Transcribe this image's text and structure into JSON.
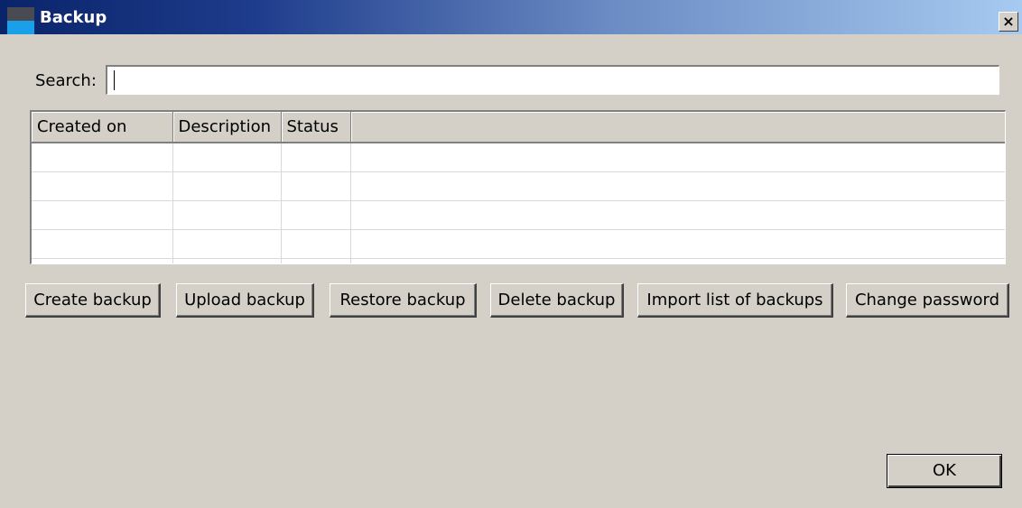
{
  "window": {
    "title": "Backup",
    "close_glyph": "×"
  },
  "search": {
    "label": "Search:",
    "value": "",
    "placeholder": ""
  },
  "table": {
    "columns": [
      "Created on",
      "Description",
      "Status"
    ],
    "rows": []
  },
  "actions": {
    "create": "Create backup",
    "upload": "Upload backup",
    "restore": "Restore backup",
    "delete": "Delete backup",
    "import": "Import list of backups",
    "change_password": "Change password"
  },
  "dialog": {
    "ok": "OK"
  },
  "colors": {
    "titlebar_start": "#0a246a",
    "titlebar_end": "#a6caf0",
    "face": "#d4d0c8"
  }
}
